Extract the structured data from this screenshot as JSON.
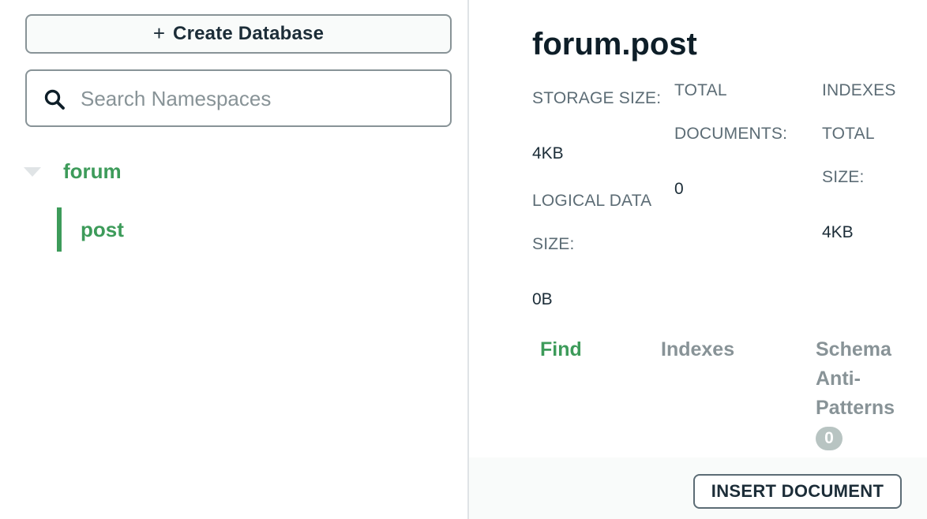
{
  "sidebar": {
    "create_database_label": "Create Database",
    "search": {
      "placeholder": "Search Namespaces",
      "value": ""
    },
    "databases": [
      {
        "name": "forum",
        "collections": [
          {
            "name": "post",
            "selected": true
          }
        ]
      }
    ]
  },
  "collection": {
    "title": "forum.post",
    "stats": {
      "storage_size_label": "STORAGE SIZE:",
      "storage_size_value": "4KB",
      "logical_size_label_line1": "LOGICAL DATA",
      "logical_size_label_line2": "SIZE:",
      "logical_size_value": "0B",
      "total_docs_label_line1": "TOTAL",
      "total_docs_label_line2": "DOCUMENTS:",
      "total_docs_value": "0",
      "indexes_label_line1": "INDEXES",
      "indexes_label_line2": "TOTAL",
      "indexes_label_line3": "SIZE:",
      "indexes_value": "4KB"
    },
    "tabs": {
      "find": "Find",
      "indexes": "Indexes",
      "schema_line1": "Schema",
      "schema_line2": "Anti-",
      "schema_line3": "Patterns",
      "schema_badge": "0",
      "active": "find"
    },
    "toolbar": {
      "insert_label": "INSERT DOCUMENT"
    }
  },
  "colors": {
    "accent_green": "#3d9b5a",
    "text_dark": "#1c2d38",
    "text_muted": "#889397",
    "border": "#889397",
    "toolbar_bg": "#f9fbfa"
  },
  "icons": {
    "create": "plus-icon",
    "search": "search-icon",
    "expand": "caret-down-icon"
  }
}
